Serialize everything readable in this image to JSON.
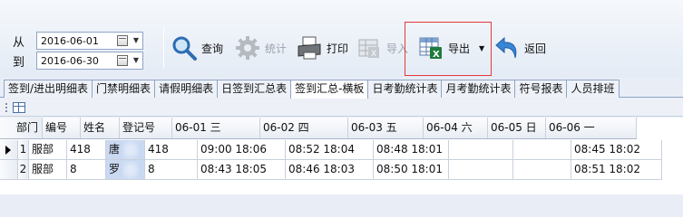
{
  "filter": {
    "from_label": "从",
    "to_label": "到",
    "from_date": "2016-06-01",
    "to_date": "2016-06-30"
  },
  "toolbar": {
    "query": "查询",
    "stats": "统计",
    "print": "打印",
    "import": "导入",
    "export": "导出",
    "back": "返回"
  },
  "tabs": [
    "签到/进出明细表",
    "门禁明细表",
    "请假明细表",
    "日签到汇总表",
    "签到汇总-横板",
    "日考勤统计表",
    "月考勤统计表",
    "符号报表",
    "人员排班"
  ],
  "active_tab": "签到汇总-横板",
  "grid": {
    "columns": [
      "部门",
      "编号",
      "姓名",
      "登记号",
      "06-01 三",
      "06-02 四",
      "06-03 五",
      "06-04 六",
      "06-05 日",
      "06-06 一"
    ],
    "rows": [
      {
        "num": "1",
        "cells": [
          "服部",
          "418",
          "唐",
          "418",
          "09:00 18:06",
          "08:52 18:04",
          "08:48 18:01",
          "",
          "",
          "08:45 18:02"
        ]
      },
      {
        "num": "2",
        "cells": [
          "服部",
          "8",
          "罗",
          "8",
          "08:43 18:05",
          "08:46 18:03",
          "08:50 18:01",
          "",
          "",
          "08:51 18:02"
        ]
      }
    ]
  },
  "colors": {
    "highlight": "#e23a3a",
    "selection": "#c9d9f1"
  }
}
